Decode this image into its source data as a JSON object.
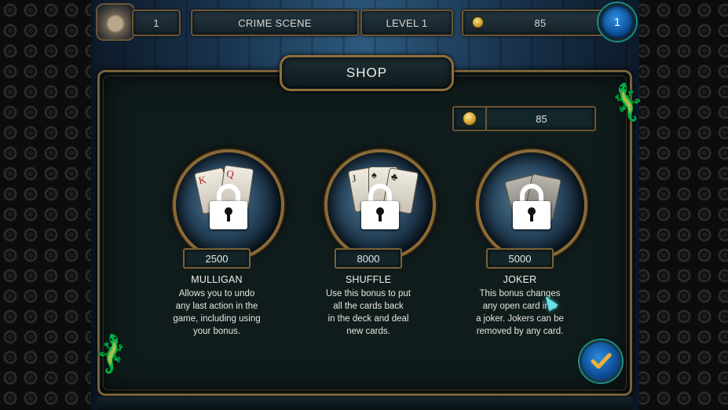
{
  "hud": {
    "player_level": "1",
    "location": "CRIME SCENE",
    "level_label": "LEVEL 1",
    "coins": "85",
    "hint_count": "1"
  },
  "shop": {
    "title": "SHOP",
    "coins": "85",
    "items": [
      {
        "name": "MULLIGAN",
        "price": "2500",
        "description": "Allows you to undo\nany last action in the\ngame, including using\nyour bonus.",
        "locked": true
      },
      {
        "name": "SHUFFLE",
        "price": "8000",
        "description": "Use this bonus to put\nall the cards back\nin the deck and deal\nnew cards.",
        "locked": true
      },
      {
        "name": "JOKER",
        "price": "5000",
        "description": "This bonus changes\nany open card into\na joker. Jokers can be\nremoved by any card.",
        "locked": true
      }
    ]
  },
  "colors": {
    "frame_gold": "#7a6236",
    "panel_bg": "#101c1c",
    "accent_blue": "#0d4d95",
    "accent_teal": "#1a8f88"
  }
}
